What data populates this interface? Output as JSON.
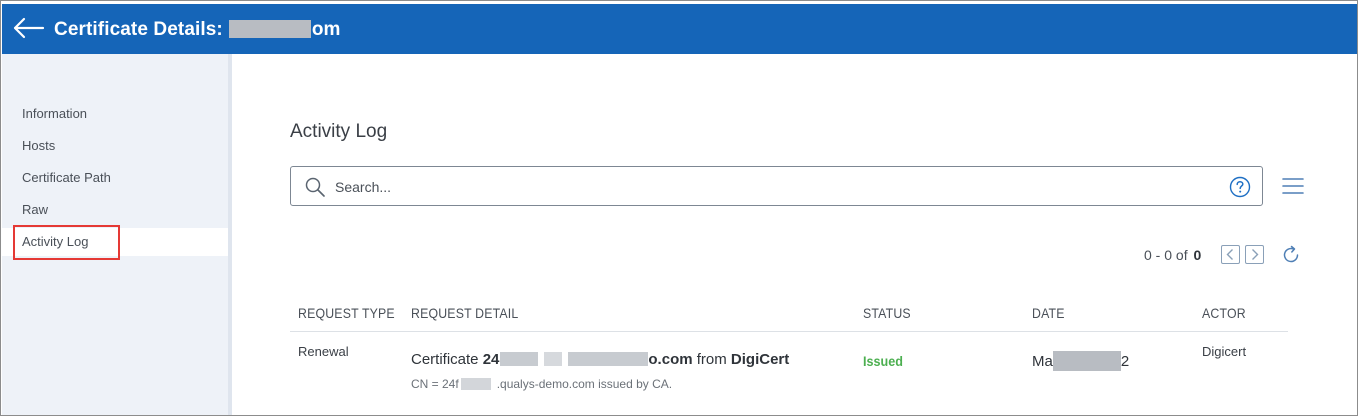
{
  "header": {
    "title_prefix": "Certificate Details:",
    "title_suffix": "om"
  },
  "sidebar": {
    "items": [
      {
        "label": "Information"
      },
      {
        "label": "Hosts"
      },
      {
        "label": "Certificate Path"
      },
      {
        "label": "Raw"
      },
      {
        "label": "Activity Log",
        "active": true
      }
    ]
  },
  "main": {
    "section_title": "Activity Log",
    "search": {
      "placeholder": "Search...",
      "value": ""
    },
    "pager": {
      "range": "0 - 0 of",
      "total": "0"
    },
    "table": {
      "columns": [
        "REQUEST TYPE",
        "REQUEST DETAIL",
        "STATUS",
        "DATE",
        "ACTOR"
      ],
      "rows": [
        {
          "request_type": "Renewal",
          "detail_prefix": "Certificate",
          "detail_id_start": "24",
          "detail_domain_end": "o.com",
          "detail_from": "from",
          "detail_ca": "DigiCert",
          "detail_sub_prefix": "CN = 24f",
          "detail_sub_suffix": ".qualys-demo.com issued by CA.",
          "status": "Issued",
          "date_start": "Ma",
          "date_end": "2",
          "actor": "Digicert"
        }
      ]
    }
  },
  "colors": {
    "header_bg": "#1565b8",
    "sidebar_bg": "#eef2f8",
    "highlight": "#e53935",
    "status_issued": "#4caf50"
  },
  "icons": [
    "back-arrow-icon",
    "search-icon",
    "help-icon",
    "hamburger-menu-icon",
    "chevron-left-icon",
    "chevron-right-icon",
    "refresh-icon"
  ]
}
